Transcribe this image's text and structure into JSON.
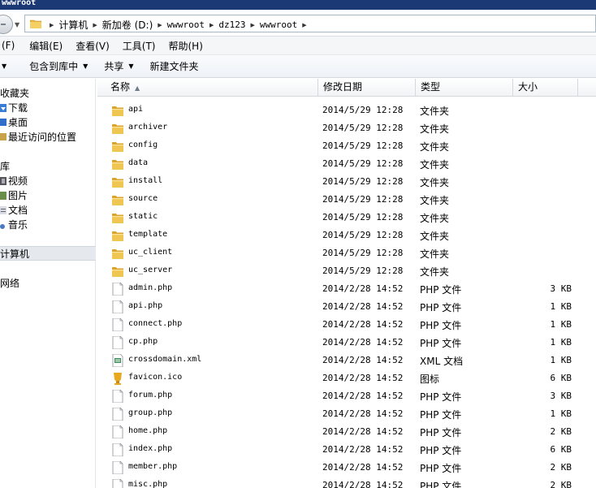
{
  "window": {
    "title": "wwwroot"
  },
  "address": {
    "crumbs": [
      "计算机",
      "新加卷 (D:)",
      "wwwroot",
      "dz123",
      "wwwroot"
    ]
  },
  "menu": [
    "(F)",
    "编辑(E)",
    "查看(V)",
    "工具(T)",
    "帮助(H)"
  ],
  "toolbar": {
    "include_library": "包含到库中",
    "share": "共享",
    "new_folder": "新建文件夹"
  },
  "nav": {
    "favorites": "收藏夹",
    "downloads": "下载",
    "desktop": "桌面",
    "recent": "最近访问的位置",
    "libraries": "库",
    "videos": "视频",
    "pictures": "图片",
    "documents": "文档",
    "music": "音乐",
    "computer": "计算机",
    "network": "网络"
  },
  "columns": {
    "name": "名称",
    "date": "修改日期",
    "type": "类型",
    "size": "大小"
  },
  "files": [
    {
      "name": "api",
      "date": "2014/5/29 12:28",
      "type": "文件夹",
      "size": "",
      "kind": "folder"
    },
    {
      "name": "archiver",
      "date": "2014/5/29 12:28",
      "type": "文件夹",
      "size": "",
      "kind": "folder"
    },
    {
      "name": "config",
      "date": "2014/5/29 12:28",
      "type": "文件夹",
      "size": "",
      "kind": "folder"
    },
    {
      "name": "data",
      "date": "2014/5/29 12:28",
      "type": "文件夹",
      "size": "",
      "kind": "folder"
    },
    {
      "name": "install",
      "date": "2014/5/29 12:28",
      "type": "文件夹",
      "size": "",
      "kind": "folder"
    },
    {
      "name": "source",
      "date": "2014/5/29 12:28",
      "type": "文件夹",
      "size": "",
      "kind": "folder"
    },
    {
      "name": "static",
      "date": "2014/5/29 12:28",
      "type": "文件夹",
      "size": "",
      "kind": "folder"
    },
    {
      "name": "template",
      "date": "2014/5/29 12:28",
      "type": "文件夹",
      "size": "",
      "kind": "folder"
    },
    {
      "name": "uc_client",
      "date": "2014/5/29 12:28",
      "type": "文件夹",
      "size": "",
      "kind": "folder"
    },
    {
      "name": "uc_server",
      "date": "2014/5/29 12:28",
      "type": "文件夹",
      "size": "",
      "kind": "folder"
    },
    {
      "name": "admin.php",
      "date": "2014/2/28 14:52",
      "type": "PHP 文件",
      "size": "3 KB",
      "kind": "file"
    },
    {
      "name": "api.php",
      "date": "2014/2/28 14:52",
      "type": "PHP 文件",
      "size": "1 KB",
      "kind": "file"
    },
    {
      "name": "connect.php",
      "date": "2014/2/28 14:52",
      "type": "PHP 文件",
      "size": "1 KB",
      "kind": "file"
    },
    {
      "name": "cp.php",
      "date": "2014/2/28 14:52",
      "type": "PHP 文件",
      "size": "1 KB",
      "kind": "file"
    },
    {
      "name": "crossdomain.xml",
      "date": "2014/2/28 14:52",
      "type": "XML 文档",
      "size": "1 KB",
      "kind": "xml"
    },
    {
      "name": "favicon.ico",
      "date": "2014/2/28 14:52",
      "type": "图标",
      "size": "6 KB",
      "kind": "ico"
    },
    {
      "name": "forum.php",
      "date": "2014/2/28 14:52",
      "type": "PHP 文件",
      "size": "3 KB",
      "kind": "file"
    },
    {
      "name": "group.php",
      "date": "2014/2/28 14:52",
      "type": "PHP 文件",
      "size": "1 KB",
      "kind": "file"
    },
    {
      "name": "home.php",
      "date": "2014/2/28 14:52",
      "type": "PHP 文件",
      "size": "2 KB",
      "kind": "file"
    },
    {
      "name": "index.php",
      "date": "2014/2/28 14:52",
      "type": "PHP 文件",
      "size": "6 KB",
      "kind": "file"
    },
    {
      "name": "member.php",
      "date": "2014/2/28 14:52",
      "type": "PHP 文件",
      "size": "2 KB",
      "kind": "file"
    },
    {
      "name": "misc.php",
      "date": "2014/2/28 14:52",
      "type": "PHP 文件",
      "size": "2 KB",
      "kind": "file"
    }
  ],
  "colors": {
    "title_bar": "#1b3a75",
    "folder": "#e8b93a",
    "selected_nav": "#e5e9ee"
  }
}
